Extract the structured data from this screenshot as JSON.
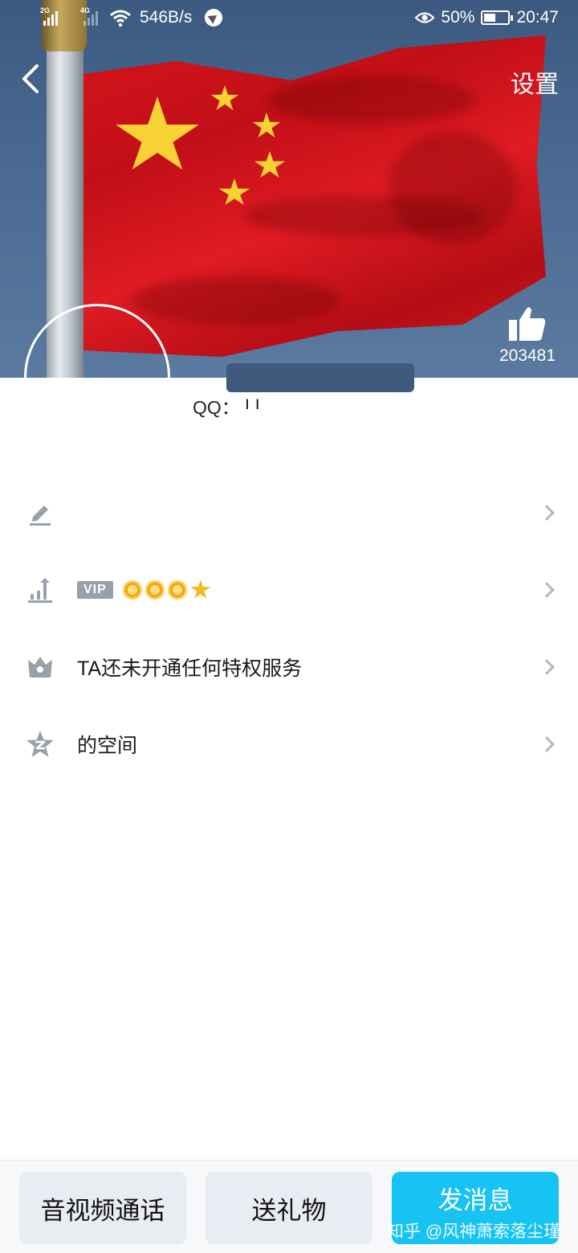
{
  "status_bar": {
    "net_type_1": "2G",
    "net_type_2": "4G",
    "speed": "546B/s",
    "battery": "50%",
    "battery_level": 0.5,
    "time": "20:47"
  },
  "header": {
    "settings_label": "设置",
    "like_count": "203481"
  },
  "profile": {
    "qq_label": "QQ：",
    "qq_value": "ı ı"
  },
  "rows": [
    {
      "icon": "edit-icon",
      "text": ""
    },
    {
      "icon": "level-icon",
      "vip_label": "VIP"
    },
    {
      "icon": "crown-icon",
      "text": "TA还未开通任何特权服务"
    },
    {
      "icon": "qzone-star-icon",
      "text": "的空间"
    }
  ],
  "actions": {
    "call": "音视频通话",
    "gift": "送礼物",
    "message": "发消息"
  },
  "watermark": "知乎 @风神萧索落尘瑾",
  "colors": {
    "accent": "#16c3f2",
    "flag_red": "#d5141c",
    "star_yellow": "#f7d234",
    "icon_gray": "#9aa0ab"
  }
}
